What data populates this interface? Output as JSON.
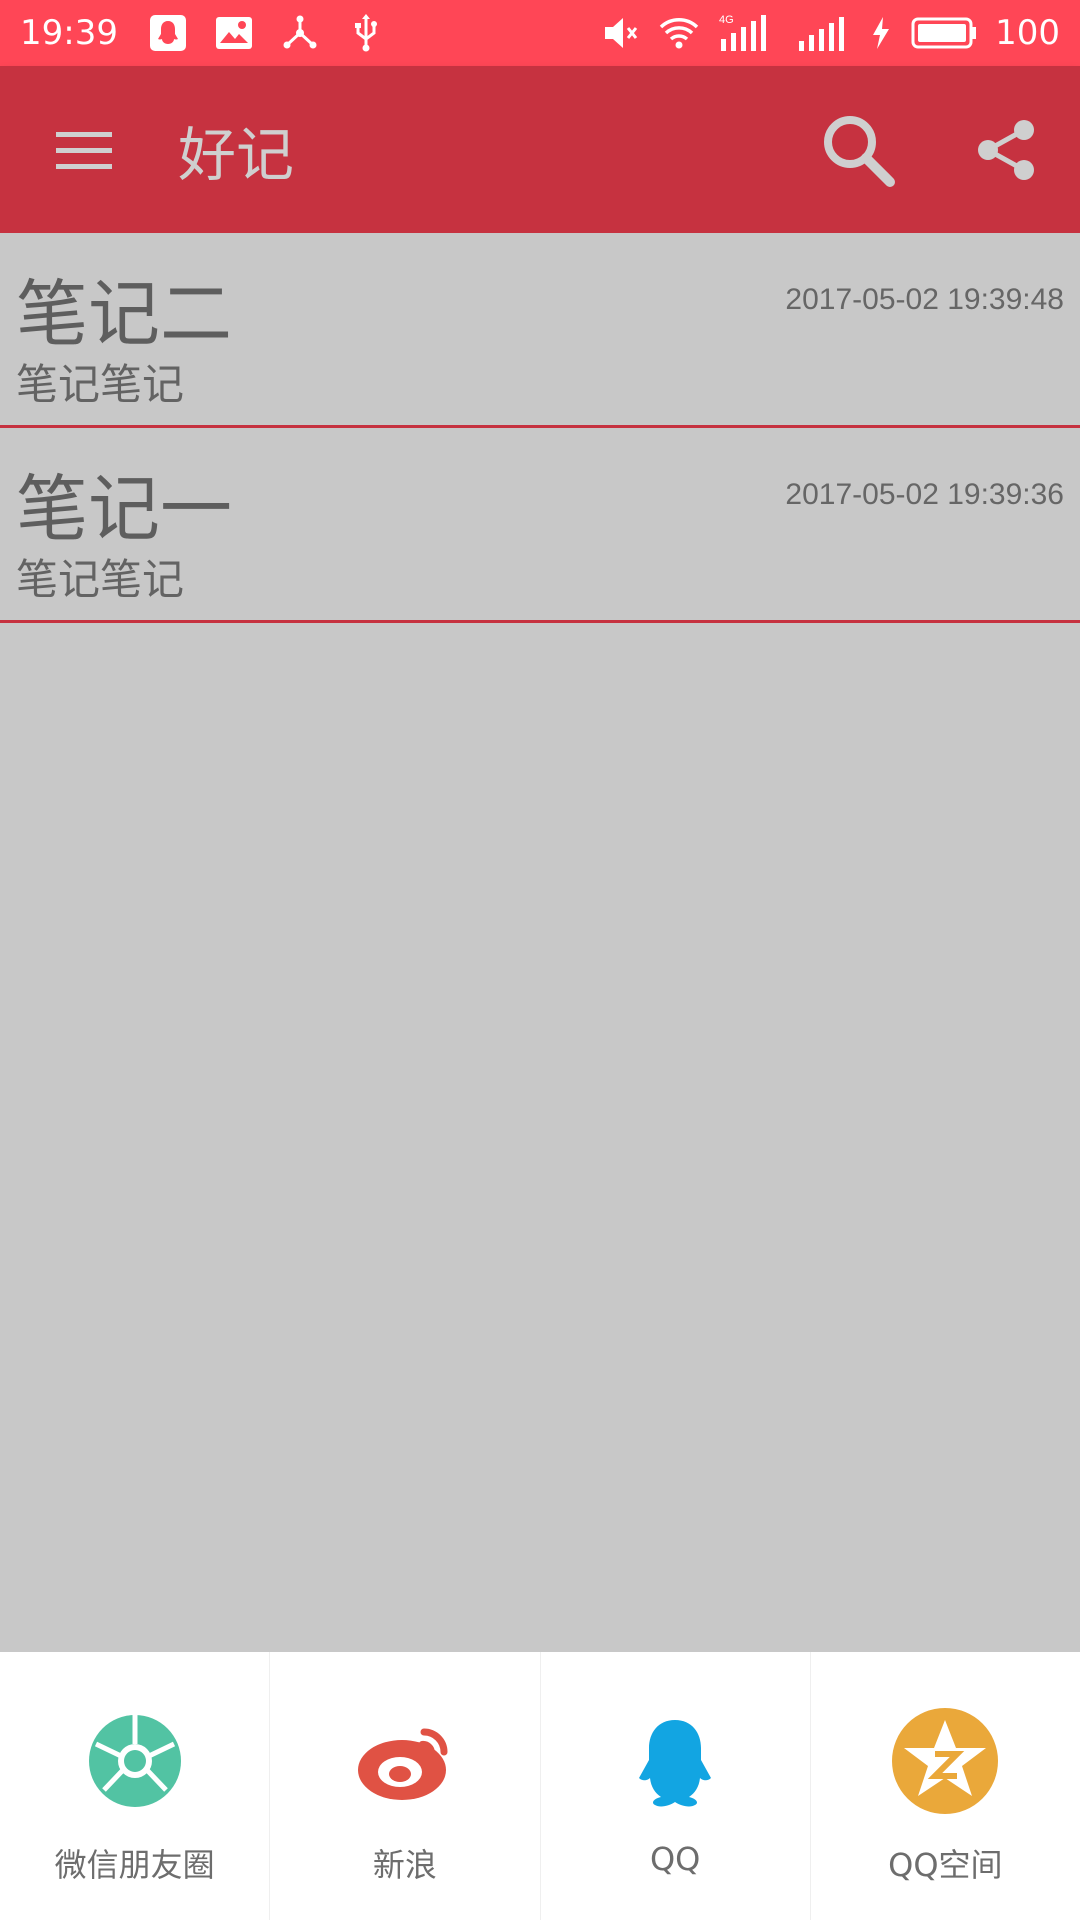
{
  "status_bar": {
    "time": "19:39",
    "battery": "100",
    "network_label": "4G",
    "icons": [
      "qq-icon",
      "image-icon",
      "network-icon",
      "usb-icon",
      "mute-icon",
      "wifi-icon",
      "signal-icon",
      "charging-icon",
      "battery-icon"
    ]
  },
  "app_bar": {
    "title": "好记",
    "background": "#c63240",
    "icons": [
      "menu-icon",
      "search-icon",
      "share-icon"
    ]
  },
  "notes": [
    {
      "title": "笔记二",
      "body": "笔记笔记",
      "time": "2017-05-02 19:39:48"
    },
    {
      "title": "笔记一",
      "body": "笔记笔记",
      "time": "2017-05-02 19:39:36"
    }
  ],
  "share": {
    "items": [
      {
        "label": "微信朋友圈",
        "icon": "wechat-moments-icon",
        "color": "#52c3a3"
      },
      {
        "label": "新浪",
        "icon": "weibo-icon",
        "color": "#e05244"
      },
      {
        "label": "QQ",
        "icon": "qq-icon",
        "color": "#12a5e2"
      },
      {
        "label": "QQ空间",
        "icon": "qzone-icon",
        "color": "#eaa83a"
      }
    ]
  }
}
